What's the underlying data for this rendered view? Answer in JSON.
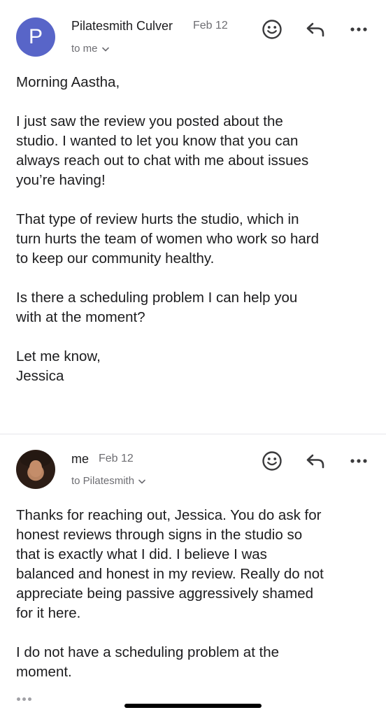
{
  "messages": [
    {
      "avatar_letter": "P",
      "sender": "Pilatesmith Culver",
      "date": "Feb 12",
      "recipient": "to me",
      "paragraphs": [
        [
          "Morning Aastha,"
        ],
        [
          "I just saw the review you posted about the",
          "studio. I wanted to let you know that you can",
          "always reach out to chat with me about issues",
          "you’re having!"
        ],
        [
          "That type of review hurts the studio, which in",
          "turn hurts the team of women who work so hard",
          "to keep our community healthy."
        ],
        [
          "Is there a scheduling problem I can help you",
          "with at the moment?"
        ],
        [
          "Let me know,",
          "Jessica"
        ]
      ]
    },
    {
      "sender": "me",
      "date": "Feb 12",
      "recipient": "to Pilatesmith",
      "paragraphs": [
        [
          "Thanks for reaching out, Jessica. You do ask for",
          "honest reviews through signs in the studio so",
          "that is exactly what I did. I believe I was",
          "balanced and honest in my review. Really do not",
          "appreciate being passive aggressively shamed",
          "for it here."
        ],
        [
          "I do not have a scheduling problem at the",
          "moment."
        ]
      ]
    }
  ],
  "icons": {
    "react": "emoji-smile-icon",
    "reply": "reply-arrow-icon",
    "more": "more-horizontal-icon",
    "expand": "chevron-down-icon",
    "trimmed": "trimmed-content-dots-icon"
  },
  "colors": {
    "avatar": "#5865c8",
    "text": "#1c1c1e",
    "secondary": "#6e6e73",
    "icon": "#3a3a3c"
  }
}
